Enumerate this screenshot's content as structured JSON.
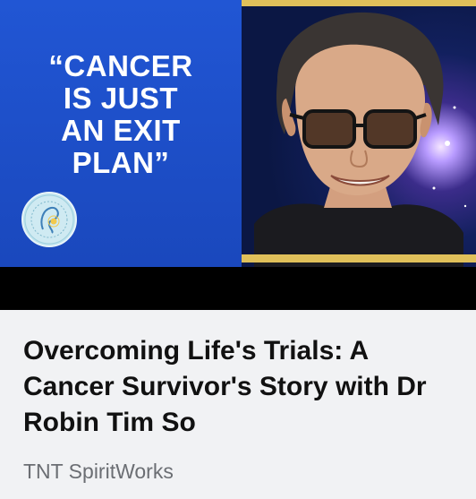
{
  "thumbnail": {
    "quote_text": "“CANCER\nIS JUST\nAN EXIT\nPLAN”",
    "colors": {
      "left_panel": "#2156d4",
      "gold_border": "#e0c05a",
      "caption_background": "#f1f2f4"
    }
  },
  "card": {
    "title": "Overcoming Life's Trials: A Cancer Survivor's Story with Dr Robin Tim So",
    "source": "TNT SpiritWorks"
  }
}
